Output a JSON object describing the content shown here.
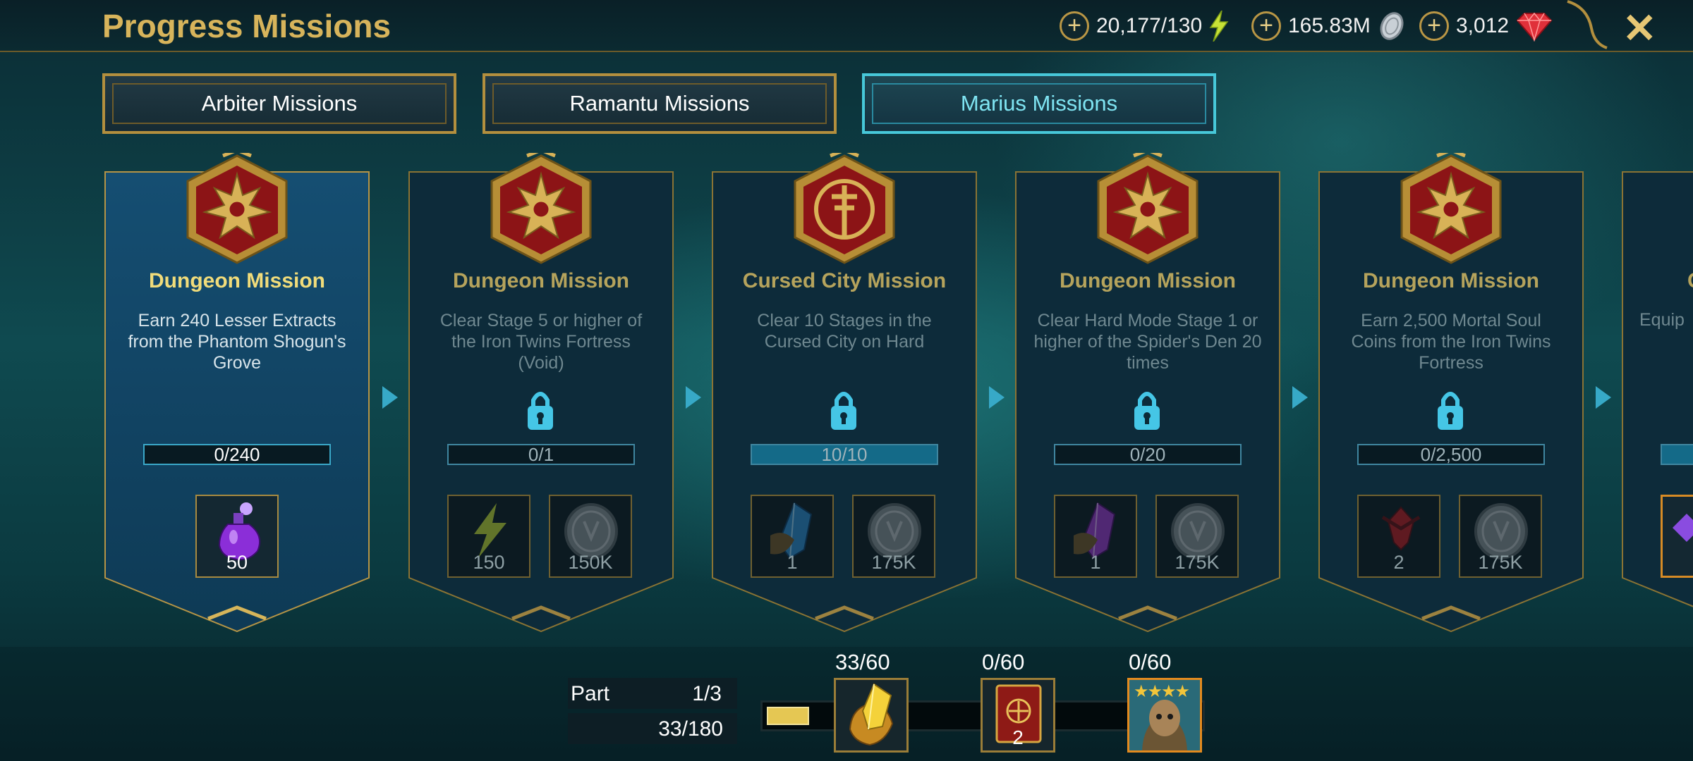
{
  "header": {
    "title": "Progress Missions",
    "resources": [
      {
        "name": "energy",
        "value": "20,177/130",
        "icon": "lightning-icon"
      },
      {
        "name": "silver",
        "value": "165.83M",
        "icon": "silver-coin-icon"
      },
      {
        "name": "gems",
        "value": "3,012",
        "icon": "ruby-gem-icon"
      }
    ],
    "close_icon": "close-icon"
  },
  "tabs": [
    {
      "label": "Arbiter Missions",
      "active": false
    },
    {
      "label": "Ramantu Missions",
      "active": false
    },
    {
      "label": "Marius Missions",
      "active": true
    }
  ],
  "missions": [
    {
      "title": "Dungeon Mission",
      "desc": "Earn 240 Lesser Extracts from the Phantom Shogun's Grove",
      "progress": "0/240",
      "progress_fraction": 0,
      "locked": false,
      "emblem": "dragon-crest-icon",
      "rewards": [
        {
          "icon": "potion-icon",
          "qty": "50"
        }
      ]
    },
    {
      "title": "Dungeon Mission",
      "desc": "Clear Stage 5 or higher of the Iron Twins Fortress (Void)",
      "progress": "0/1",
      "progress_fraction": 0,
      "locked": true,
      "emblem": "dragon-crest-icon",
      "rewards": [
        {
          "icon": "energy-icon",
          "qty": "150"
        },
        {
          "icon": "silver-coin-icon",
          "qty": "150K"
        }
      ]
    },
    {
      "title": "Cursed City Mission",
      "desc": "Clear 10 Stages in the Cursed City on Hard",
      "progress": "10/10",
      "progress_fraction": 1,
      "locked": true,
      "emblem": "cursed-city-crest-icon",
      "rewards": [
        {
          "icon": "blue-shard-icon",
          "qty": "1"
        },
        {
          "icon": "silver-coin-icon",
          "qty": "175K"
        }
      ]
    },
    {
      "title": "Dungeon Mission",
      "desc": "Clear Hard Mode Stage 1 or higher of the Spider's Den 20 times",
      "progress": "0/20",
      "progress_fraction": 0,
      "locked": true,
      "emblem": "dragon-crest-icon",
      "rewards": [
        {
          "icon": "void-shard-icon",
          "qty": "1"
        },
        {
          "icon": "silver-coin-icon",
          "qty": "175K"
        }
      ]
    },
    {
      "title": "Dungeon Mission",
      "desc": "Earn 2,500 Mortal Soul Coins from the Iron Twins Fortress",
      "progress": "0/2,500",
      "progress_fraction": 0,
      "locked": true,
      "emblem": "dragon-crest-icon",
      "rewards": [
        {
          "icon": "blood-shard-icon",
          "qty": "2"
        },
        {
          "icon": "silver-coin-icon",
          "qty": "175K"
        }
      ]
    },
    {
      "title": "C",
      "desc": "Equip",
      "partial": true
    }
  ],
  "footer": {
    "part_label": "Part",
    "part_value": "1/3",
    "total_progress": "33/180",
    "total_fraction": 0.18,
    "milestones": [
      {
        "label": "33/60",
        "icon": "gold-helmet-shard-icon"
      },
      {
        "label": "0/60",
        "icon": "red-tome-icon",
        "qty": "2"
      },
      {
        "label": "0/60",
        "icon": "hero-portrait-icon",
        "stars": "★★★★"
      }
    ]
  }
}
